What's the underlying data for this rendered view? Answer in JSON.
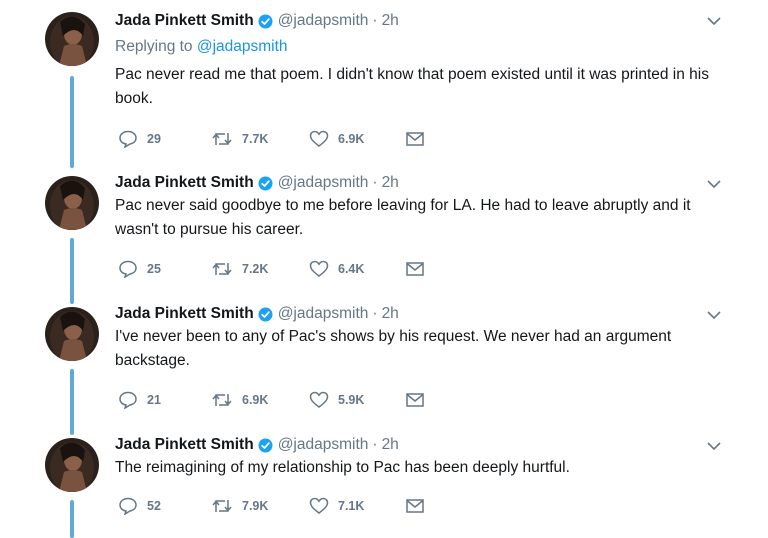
{
  "colors": {
    "thread_line": "#5fa9d6",
    "verified": "#1da1f2",
    "mention": "#1b95e0",
    "secondary_text": "#657786"
  },
  "icons": {
    "reply": "speech-bubble-icon",
    "retweet": "retweet-arrows-icon",
    "like": "heart-icon",
    "message": "envelope-icon",
    "menu": "chevron-down-icon",
    "verified": "verified-badge-icon"
  },
  "tweets": [
    {
      "author": "Jada Pinkett Smith",
      "handle": "@jadapsmith",
      "separator": "·",
      "time": "2h",
      "reply_prefix": "Replying to ",
      "reply_to": "@jadapsmith",
      "text": "Pac never read me that poem. I didn't know that poem existed until it was printed in his book.",
      "replies": "29",
      "retweets": "7.7K",
      "likes": "6.9K"
    },
    {
      "author": "Jada Pinkett Smith",
      "handle": "@jadapsmith",
      "separator": "·",
      "time": "2h",
      "text": "Pac never said goodbye to me before leaving for LA. He had to leave abruptly and it wasn't to pursue his career.",
      "replies": "25",
      "retweets": "7.2K",
      "likes": "6.4K"
    },
    {
      "author": "Jada Pinkett Smith",
      "handle": "@jadapsmith",
      "separator": "·",
      "time": "2h",
      "text": "I've never been to any of Pac's shows by his request. We never had an argument backstage.",
      "replies": "21",
      "retweets": "6.9K",
      "likes": "5.9K"
    },
    {
      "author": "Jada Pinkett Smith",
      "handle": "@jadapsmith",
      "separator": "·",
      "time": "2h",
      "text": "The reimagining of my relationship to Pac has been deeply hurtful.",
      "replies": "52",
      "retweets": "7.9K",
      "likes": "7.1K"
    }
  ]
}
